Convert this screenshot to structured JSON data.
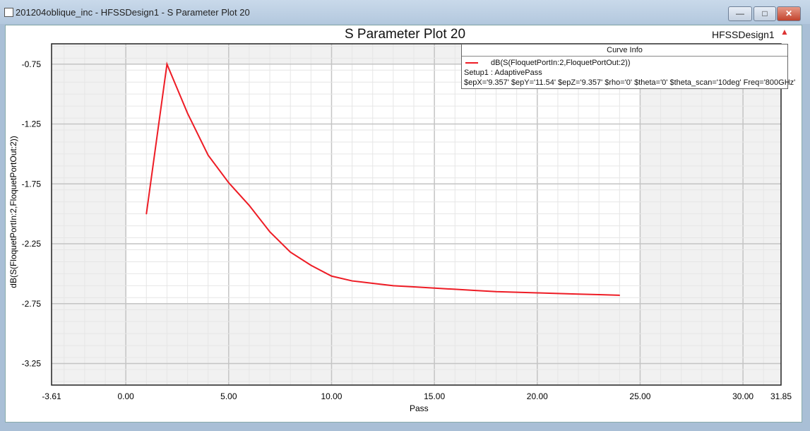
{
  "window": {
    "title": "201204oblique_inc - HFSSDesign1 - S Parameter Plot 20",
    "minimize": "—",
    "maximize": "□",
    "close": "✕"
  },
  "plot": {
    "title": "S Parameter Plot 20",
    "design": "HFSSDesign1",
    "logo_icon": "ansys-logo-icon"
  },
  "legend": {
    "header": "Curve Info",
    "curve": "dB(S(FloquetPortIn:2,FloquetPortOut:2))",
    "setup": "Setup1 : AdaptivePass",
    "vars": "$epX='9.357' $epY='11.54' $epZ='9.357' $rho='0' $theta='0' $theta_scan='10deg' Freq='800GHz'",
    "color": "#ee1c25"
  },
  "chart_data": {
    "type": "line",
    "title": "S Parameter Plot 20",
    "xlabel": "Pass",
    "ylabel": "dB(S(FloquetPortIn:2,FloquetPortOut:2))",
    "xlim": [
      -3.61,
      31.85
    ],
    "ylim": [
      -3.43,
      -0.58
    ],
    "xticks": [
      "-3.61",
      "0.00",
      "5.00",
      "10.00",
      "15.00",
      "20.00",
      "25.00",
      "30.00",
      "31.85"
    ],
    "yticks": [
      "-0.75",
      "-1.25",
      "-1.75",
      "-2.25",
      "-2.75",
      "-3.25"
    ],
    "grid": true,
    "series": [
      {
        "name": "dB(S(FloquetPortIn:2,FloquetPortOut:2))",
        "color": "#ee1c25",
        "x": [
          1,
          2,
          3,
          4,
          5,
          6,
          7,
          8,
          9,
          10,
          11,
          12,
          13,
          14,
          15,
          16,
          17,
          18,
          19,
          20,
          21,
          22,
          23,
          24
        ],
        "y": [
          -2.0,
          -0.75,
          -1.16,
          -1.51,
          -1.74,
          -1.93,
          -2.15,
          -2.32,
          -2.43,
          -2.52,
          -2.56,
          -2.58,
          -2.6,
          -2.61,
          -2.62,
          -2.63,
          -2.64,
          -2.65,
          -2.655,
          -2.66,
          -2.665,
          -2.67,
          -2.675,
          -2.68
        ]
      }
    ]
  }
}
